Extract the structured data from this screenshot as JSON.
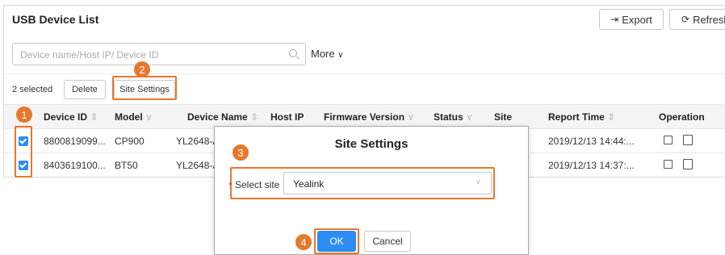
{
  "panel": {
    "title": "USB Device List"
  },
  "toolbar": {
    "export_label": "Export",
    "refresh_label": "Refresh"
  },
  "search": {
    "placeholder": "Device name/Host IP/ Device ID",
    "more_label": "More"
  },
  "bulk": {
    "selected_count": "2 selected",
    "delete_label": "Delete",
    "site_settings_label": "Site Settings"
  },
  "table": {
    "columns": {
      "device_id": "Device ID",
      "model": "Model",
      "device_name": "Device Name",
      "host_ip": "Host IP",
      "firmware": "Firmware Version",
      "status": "Status",
      "site": "Site",
      "report_time": "Report Time",
      "operation": "Operation"
    },
    "rows": [
      {
        "device_id": "8800819099...",
        "model": "CP900",
        "device_name": "YL2648-A(",
        "report_time": "2019/12/13 14:44:..."
      },
      {
        "device_id": "8403619100...",
        "model": "BT50",
        "device_name": "YL2648-A(",
        "report_time": "2019/12/13 14:37:..."
      }
    ]
  },
  "modal": {
    "title": "Site Settings",
    "select_label": "Select site",
    "select_value": "Yealink",
    "ok_label": "OK",
    "cancel_label": "Cancel"
  },
  "callouts": {
    "c1": "1",
    "c2": "2",
    "c3": "3",
    "c4": "4"
  },
  "colors": {
    "accent": "#2d8cf0",
    "callout": "#e8772e",
    "required": "#e53935"
  },
  "icons": {
    "export": "export-icon",
    "refresh": "refresh-icon",
    "search": "search-icon",
    "more": "chevron-down-icon",
    "sort": "sort-icon",
    "filter": "chevron-down-icon",
    "edit": "edit-icon",
    "upload": "upload-icon",
    "select_caret": "chevron-down-icon"
  }
}
